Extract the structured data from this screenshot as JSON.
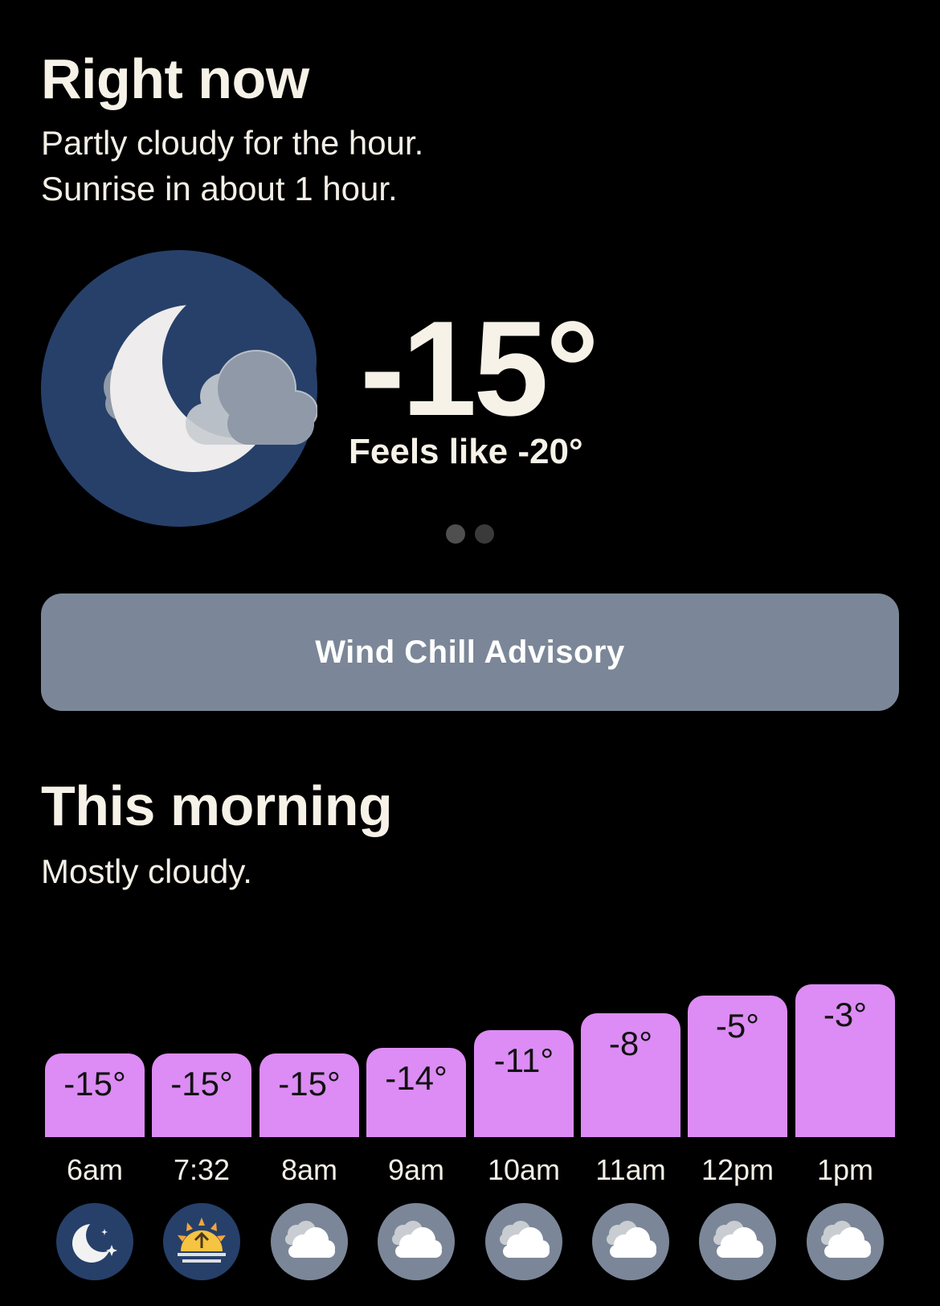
{
  "now": {
    "title": "Right now",
    "line1": "Partly cloudy for the hour.",
    "line2": "Sunrise in about 1 hour.",
    "icon": "moon-cloud-icon",
    "temperature": "-15°",
    "feels_like": "Feels like -20°",
    "page_dots": 2,
    "active_dot": 0
  },
  "advisory": {
    "label": "Wind Chill Advisory"
  },
  "morning": {
    "title": "This morning",
    "summary": "Mostly cloudy."
  },
  "colors": {
    "background": "#000000",
    "bar": "#dc8cf4",
    "advisory": "#7b8798",
    "night_icon": "#26406a",
    "cloud_icon": "#7b8798"
  },
  "chart_data": {
    "type": "bar",
    "categories": [
      "6am",
      "7:32",
      "8am",
      "9am",
      "10am",
      "11am",
      "12pm",
      "1pm"
    ],
    "values": [
      -15,
      -15,
      -15,
      -14,
      -11,
      -8,
      -5,
      -3
    ],
    "labels": [
      "-15°",
      "-15°",
      "-15°",
      "-14°",
      "-11°",
      "-8°",
      "-5°",
      "-3°"
    ],
    "icons": [
      "moon-icon",
      "sunrise-icon",
      "cloud-icon",
      "cloud-icon",
      "cloud-icon",
      "cloud-icon",
      "cloud-icon",
      "cloud-icon"
    ]
  }
}
